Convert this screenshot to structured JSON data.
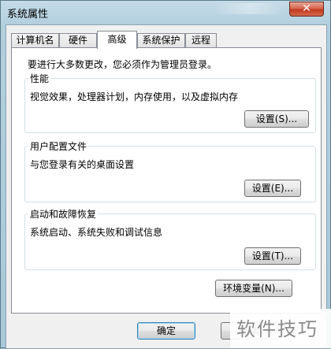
{
  "window": {
    "title": "系统属性",
    "close_symbol": "✕"
  },
  "tabs": [
    {
      "label": "计算机名",
      "active": false
    },
    {
      "label": "硬件",
      "active": false
    },
    {
      "label": "高级",
      "active": true
    },
    {
      "label": "系统保护",
      "active": false
    },
    {
      "label": "远程",
      "active": false
    }
  ],
  "panel": {
    "notice": "要进行大多数更改，您必须作为管理员登录。",
    "groups": [
      {
        "title": "性能",
        "description": "视觉效果，处理器计划，内存使用，以及虚拟内存",
        "button": "设置(S)..."
      },
      {
        "title": "用户配置文件",
        "description": "与您登录有关的桌面设置",
        "button": "设置(E)..."
      },
      {
        "title": "启动和故障恢复",
        "description": "系统启动、系统失败和调试信息",
        "button": "设置(T)..."
      }
    ],
    "env_button": "环境变量(N)..."
  },
  "footer": {
    "ok": "确定",
    "cancel": "取消"
  },
  "watermark": "软件技巧",
  "colors": {
    "close_button": "#c23a1f",
    "default_button_border": "#3c7fb1",
    "title_bar": "#b3cfde"
  }
}
